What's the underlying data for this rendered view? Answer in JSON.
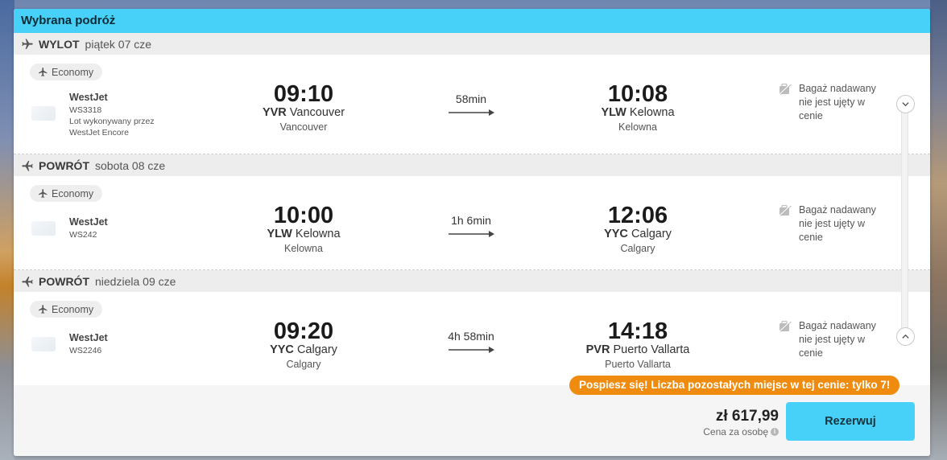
{
  "header": {
    "title": "Wybrana podróż"
  },
  "segments": [
    {
      "direction": "WYLOT",
      "date": "piątek 07 cze",
      "cabin": "Economy",
      "airline": "WestJet",
      "flight_code": "WS3318",
      "operated_line1": "Lot wykonywany przez",
      "operated_line2": "WestJet Encore",
      "dep_time": "09:10",
      "dep_iata": "YVR",
      "dep_airport": "Vancouver",
      "dep_city": "Vancouver",
      "duration": "58min",
      "arr_time": "10:08",
      "arr_iata": "YLW",
      "arr_airport": "Kelowna",
      "arr_city": "Kelowna",
      "baggage": "Bagaż nadawany nie jest ujęty w cenie"
    },
    {
      "direction": "POWRÓT",
      "date": "sobota 08 cze",
      "cabin": "Economy",
      "airline": "WestJet",
      "flight_code": "WS242",
      "dep_time": "10:00",
      "dep_iata": "YLW",
      "dep_airport": "Kelowna",
      "dep_city": "Kelowna",
      "duration": "1h 6min",
      "arr_time": "12:06",
      "arr_iata": "YYC",
      "arr_airport": "Calgary",
      "arr_city": "Calgary",
      "baggage": "Bagaż nadawany nie jest ujęty w cenie"
    },
    {
      "direction": "POWRÓT",
      "date": "niedziela 09 cze",
      "cabin": "Economy",
      "airline": "WestJet",
      "flight_code": "WS2246",
      "dep_time": "09:20",
      "dep_iata": "YYC",
      "dep_airport": "Calgary",
      "dep_city": "Calgary",
      "duration": "4h 58min",
      "arr_time": "14:18",
      "arr_iata": "PVR",
      "arr_airport": "Puerto Vallarta",
      "arr_city": "Puerto Vallarta",
      "baggage": "Bagaż nadawany nie jest ujęty w cenie"
    }
  ],
  "urgency": "Pospiesz się! Liczba pozostałych miejsc w tej cenie: tylko 7!",
  "price": {
    "amount": "zł 617,99",
    "per_person": "Cena za osobę",
    "info_icon": "i"
  },
  "book_button": "Rezerwuj",
  "icons": {
    "segment": "airplane-icon",
    "cabin": "airplane-icon",
    "baggage": "no-baggage-icon",
    "scroll_down": "chevron-down-icon",
    "scroll_up": "chevron-up-icon"
  },
  "colors": {
    "accent": "#47d1f8",
    "urgency": "#ef8c0f",
    "segment_bar": "#ededed"
  }
}
